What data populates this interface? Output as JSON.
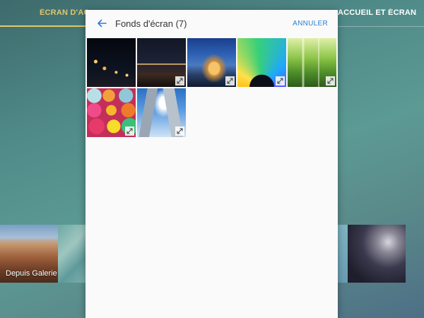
{
  "background_tabs": {
    "active_label": "ÉCRAN D'ACCUEIL",
    "other_label": "ACCUEIL ET ÉCRAN..."
  },
  "background_strip": {
    "gallery_label": "Depuis Galerie"
  },
  "dialog": {
    "title": "Fonds d'écran (7)",
    "cancel_label": "ANNULER",
    "back_icon": "back-arrow-icon",
    "accent_color": "#2b7ed6",
    "wallpapers": [
      {
        "name": "night-city",
        "has_preview": false
      },
      {
        "name": "bridge-night",
        "has_preview": true
      },
      {
        "name": "palace-of-fine-arts",
        "has_preview": true
      },
      {
        "name": "colorful-arcs",
        "has_preview": true
      },
      {
        "name": "forest",
        "has_preview": true
      },
      {
        "name": "yarn-balls",
        "has_preview": true
      },
      {
        "name": "skyscrapers",
        "has_preview": true
      }
    ]
  },
  "colors": {
    "active_tab": "#e3c86a"
  }
}
